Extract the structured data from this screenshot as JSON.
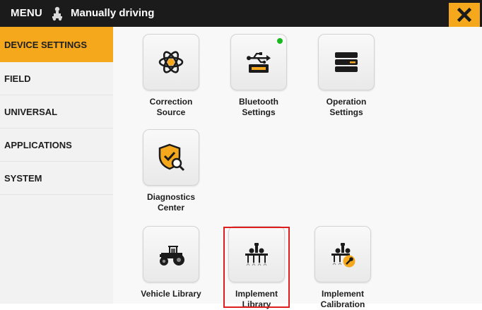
{
  "topbar": {
    "menu_label": "MENU",
    "status_text": "Manually driving",
    "driver_icon": "tractor-driver-icon",
    "close_icon": "close-x-icon",
    "accent_color": "#f5a81c"
  },
  "sidebar": {
    "items": [
      {
        "label": "DEVICE SETTINGS",
        "active": true
      },
      {
        "label": "FIELD",
        "active": false
      },
      {
        "label": "UNIVERSAL",
        "active": false
      },
      {
        "label": "APPLICATIONS",
        "active": false
      },
      {
        "label": "SYSTEM",
        "active": false
      }
    ]
  },
  "tiles": [
    {
      "label": "Correction\nSource",
      "icon": "atom-icon"
    },
    {
      "label": "Bluetooth\nSettings",
      "icon": "usb-icon",
      "status_color": "#18b81e"
    },
    {
      "label": "Operation\nSettings",
      "icon": "settings-bars-icon"
    },
    {
      "label": "Diagnostics\nCenter",
      "icon": "shield-search-icon"
    },
    {
      "label": "Vehicle Library",
      "icon": "tractor-icon"
    },
    {
      "label": "Implement\nLibrary",
      "icon": "implement-icon"
    },
    {
      "label": "Implement\nCalibration",
      "icon": "implement-wrench-icon"
    }
  ]
}
